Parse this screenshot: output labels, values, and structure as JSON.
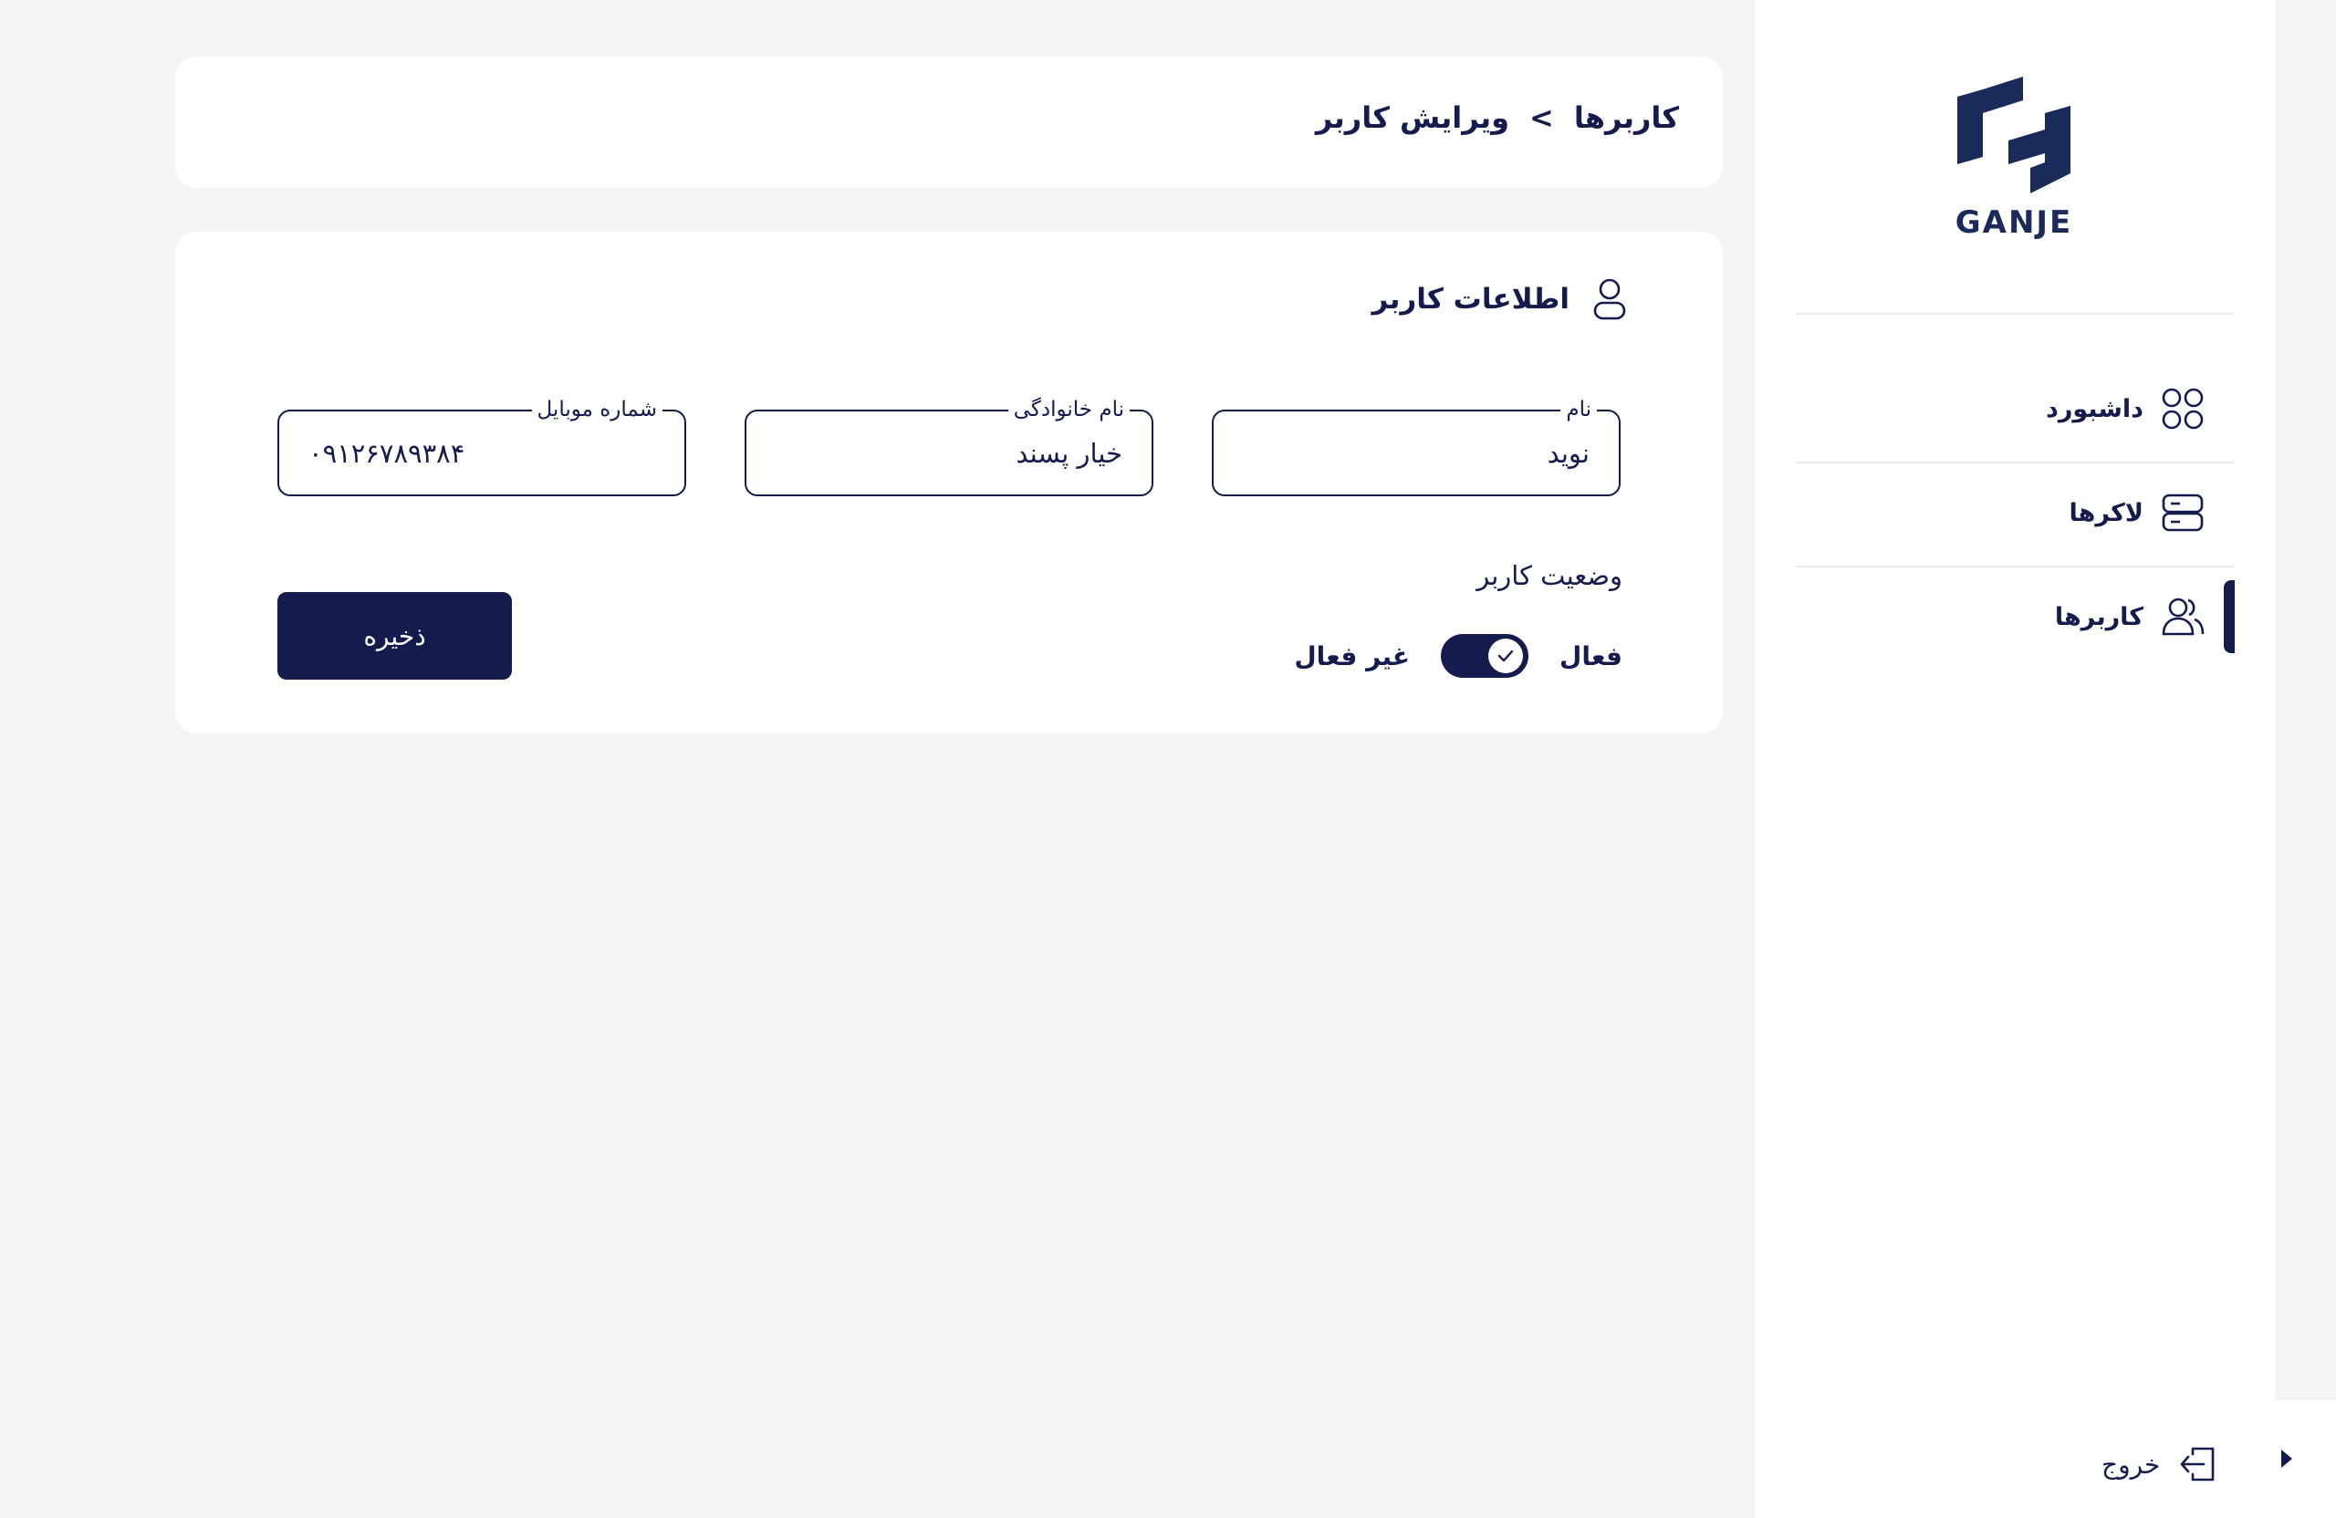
{
  "sidebar": {
    "logo_text": "GANJE",
    "items": [
      {
        "label": "داشبورد",
        "icon": "dashboard-grid-icon"
      },
      {
        "label": "لاکرها",
        "icon": "server-stack-icon"
      },
      {
        "label": "کاربرها",
        "icon": "users-icon",
        "active": true
      }
    ],
    "logout_label": "خروج"
  },
  "breadcrumb": {
    "parent": "کاربرها",
    "separator": ">",
    "current": "ویرایش کاربر"
  },
  "form": {
    "section_title": "اطلاعات کاربر",
    "fields": {
      "first_name": {
        "label": "نام",
        "value": "نوید"
      },
      "last_name": {
        "label": "نام خانوادگی",
        "value": "خیار پسند"
      },
      "mobile": {
        "label": "شماره موبایل",
        "value": "۰۹۱۲۶۷۸۹۳۸۴"
      }
    },
    "status": {
      "label": "وضعیت کاربر",
      "active_label": "فعال",
      "inactive_label": "غیر فعال",
      "is_active": true
    },
    "save_label": "ذخیره"
  },
  "colors": {
    "primary": "#141b4d",
    "background": "#f4f4f4",
    "surface": "#ffffff"
  }
}
